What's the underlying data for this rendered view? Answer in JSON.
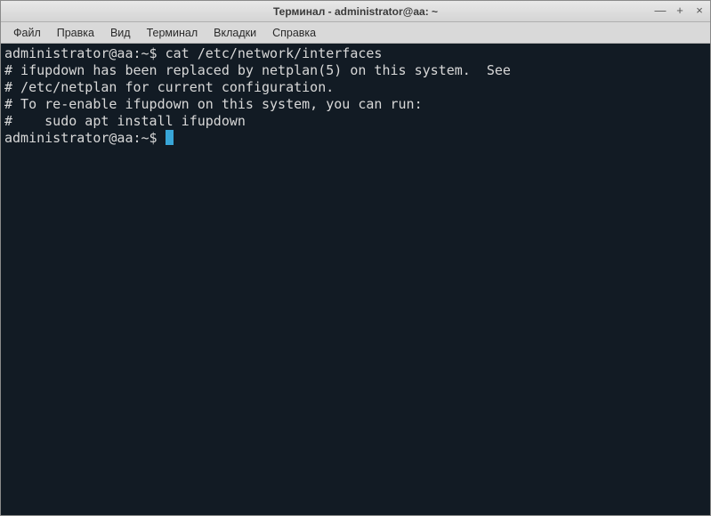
{
  "window": {
    "title": "Терминал - administrator@aa: ~"
  },
  "title_controls": {
    "minimize": "—",
    "maximize": "+",
    "close": "×"
  },
  "menubar": {
    "file": "Файл",
    "edit": "Правка",
    "view": "Вид",
    "terminal": "Терминал",
    "tabs": "Вкладки",
    "help": "Справка"
  },
  "terminal": {
    "prompt1": "administrator@aa:~$ ",
    "command1": "cat /etc/network/interfaces",
    "line1": "# ifupdown has been replaced by netplan(5) on this system.  See",
    "line2": "# /etc/netplan for current configuration.",
    "line3": "# To re-enable ifupdown on this system, you can run:",
    "line4": "#    sudo apt install ifupdown",
    "prompt2": "administrator@aa:~$ "
  }
}
